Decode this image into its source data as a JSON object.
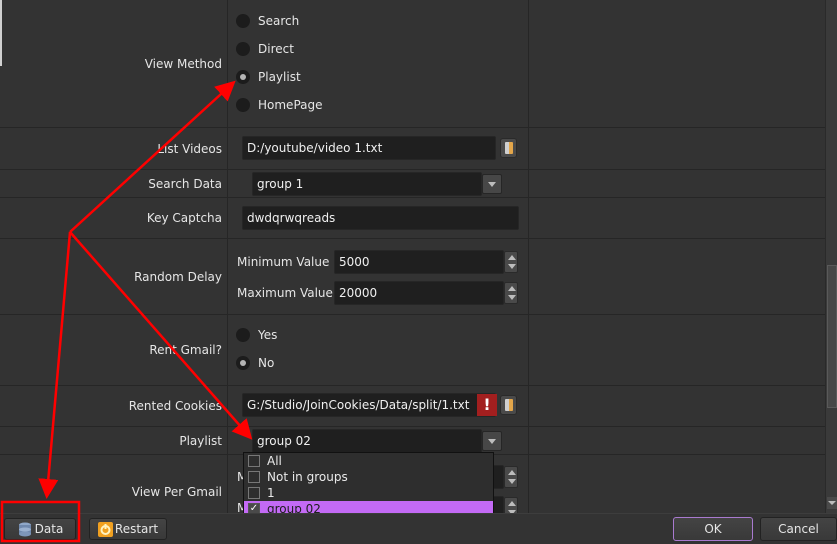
{
  "form": {
    "view_method": {
      "label": "View Method",
      "options": [
        "Search",
        "Direct",
        "Playlist",
        "HomePage"
      ],
      "selected": "Playlist"
    },
    "list_videos": {
      "label": "List Videos",
      "value": "D:/youtube/video 1.txt",
      "browse_icon": "folder-icon"
    },
    "search_data": {
      "label": "Search Data",
      "value": "group 1"
    },
    "key_captcha": {
      "label": "Key Captcha",
      "value": "dwdqrwqreads"
    },
    "random_delay": {
      "label": "Random Delay",
      "min_label": "Minimum Value",
      "min_value": "5000",
      "max_label": "Maximum Value",
      "max_value": "20000"
    },
    "rent_gmail": {
      "label": "Rent Gmail?",
      "options": [
        "Yes",
        "No"
      ],
      "selected": "No"
    },
    "rented_cookies": {
      "label": "Rented Cookies",
      "value": "G:/Studio/JoinCookies/Data/split/1.txt",
      "error_icon": "!",
      "browse_icon": "folder-icon"
    },
    "playlist": {
      "label": "Playlist",
      "value": "group 02",
      "dropdown": [
        {
          "label": "All",
          "checked": false
        },
        {
          "label": "Not in groups",
          "checked": false
        },
        {
          "label": "1",
          "checked": false
        },
        {
          "label": "group 02",
          "checked": true
        }
      ]
    },
    "view_per_gmail": {
      "label": "View Per Gmail",
      "min_label_partial": "M",
      "max_label_partial": "M"
    }
  },
  "check_glyph": "✓",
  "buttons": {
    "data": "Data",
    "restart": "Restart",
    "ok": "OK",
    "cancel": "Cancel"
  },
  "colors": {
    "background": "#333333",
    "field": "#1f1f1f",
    "highlight": "#c36af5",
    "annotation": "#ff0000",
    "error": "#a31f1f"
  }
}
